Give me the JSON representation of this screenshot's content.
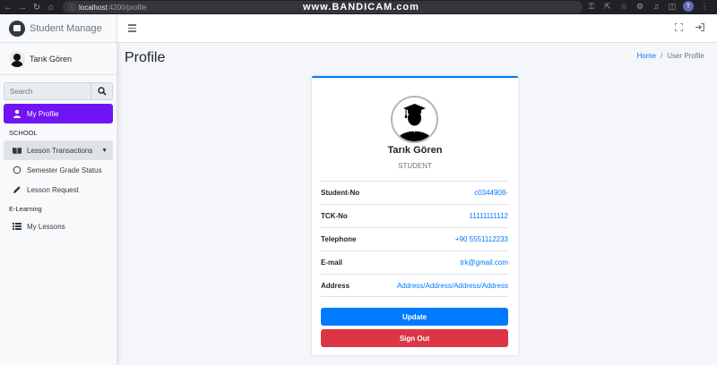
{
  "browser": {
    "url_host": "localhost",
    "url_path": ":4200/profile",
    "watermark": "www.BANDICAM.com",
    "profile_initial": "T"
  },
  "sidebar": {
    "brand": "Student Manage",
    "user_name": "Tarık Gören",
    "search_placeholder": "Search",
    "items": [
      {
        "label": "My Profile",
        "icon": "user-icon",
        "active": true
      },
      {
        "header": "SCHOOL"
      },
      {
        "label": "Lesson Transactions",
        "icon": "book-icon",
        "open": true
      },
      {
        "label": "Semester Grade Status",
        "icon": "circle-icon"
      },
      {
        "label": "Lesson Request",
        "icon": "pencil-icon"
      },
      {
        "header": "E-Learning"
      },
      {
        "label": "My Lessons",
        "icon": "list-icon"
      }
    ]
  },
  "header": {
    "title": "Profile",
    "breadcrumb_home": "Home",
    "breadcrumb_sep": "/",
    "breadcrumb_current": "User Profile"
  },
  "profile": {
    "name": "Tarık Gören",
    "role": "STUDENT",
    "fields": [
      {
        "label": "Student-No",
        "value": "c0344908-"
      },
      {
        "label": "TCK-No",
        "value": "11111111112"
      },
      {
        "label": "Telephone",
        "value": "+90 5551112233"
      },
      {
        "label": "E-mail",
        "value": "trk@gmail.com"
      },
      {
        "label": "Address",
        "value": "Address/Address/Address/Address"
      }
    ],
    "update_label": "Update",
    "signout_label": "Sign Out"
  },
  "colors": {
    "active_nav": "#6f14f5",
    "primary": "#007bff",
    "danger": "#dc3545"
  }
}
